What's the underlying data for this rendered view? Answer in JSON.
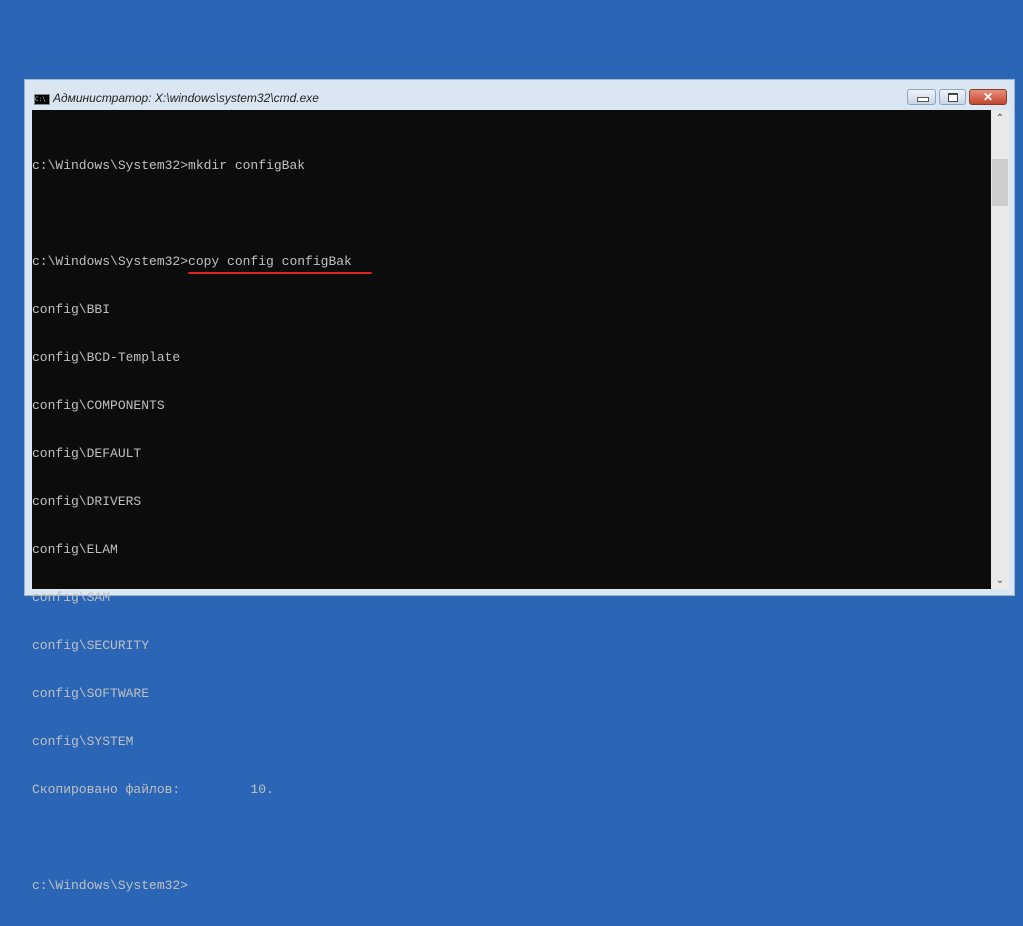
{
  "window": {
    "title": "Администратор: X:\\windows\\system32\\cmd.exe",
    "icon_text": "C:\\"
  },
  "console": {
    "lines": [
      "c:\\Windows\\System32>mkdir configBak",
      "",
      "c:\\Windows\\System32>copy config configBak",
      "config\\BBI",
      "config\\BCD-Template",
      "config\\COMPONENTS",
      "config\\DEFAULT",
      "config\\DRIVERS",
      "config\\ELAM",
      "config\\SAM",
      "config\\SECURITY",
      "config\\SOFTWARE",
      "config\\SYSTEM",
      "Скопировано файлов:         10.",
      "",
      "c:\\Windows\\System32>"
    ]
  },
  "controls": {
    "close": "✕",
    "scroll_up": "⌃",
    "scroll_down": "⌄"
  }
}
